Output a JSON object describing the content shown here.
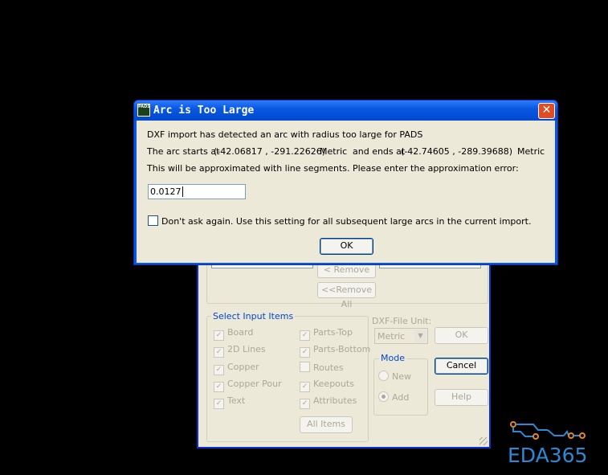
{
  "bg_dialog": {
    "remove_label": "< Remove",
    "remove_all_label": "<<Remove All",
    "select_input_items": {
      "title": "Select Input Items",
      "items": [
        {
          "label": "Board",
          "checked": true
        },
        {
          "label": "2D Lines",
          "checked": true
        },
        {
          "label": "Copper",
          "checked": true
        },
        {
          "label": "Copper Pour",
          "checked": true
        },
        {
          "label": "Text",
          "checked": true
        },
        {
          "label": "Parts-Top",
          "checked": true
        },
        {
          "label": "Parts-Bottom",
          "checked": true
        },
        {
          "label": "Routes",
          "checked": false
        },
        {
          "label": "Keepouts",
          "checked": true
        },
        {
          "label": "Attributes",
          "checked": true
        }
      ],
      "all_items_label": "All Items"
    },
    "dxf_file_unit": {
      "label": "DXF-File Unit:",
      "value": "Metric"
    },
    "ok_label": "OK",
    "cancel_label": "Cancel",
    "help_label": "Help",
    "mode": {
      "title": "Mode",
      "new_label": "New",
      "add_label": "Add",
      "selected": "Add"
    }
  },
  "dialog": {
    "title": "Arc is Too Large",
    "app_icon_text": "PADS",
    "line1": "DXF import has detected an arc with radius too large for PADS",
    "line2_prefix": "The arc starts at",
    "start_point": "(-42.06817 , -291.22626)",
    "start_unit": "Metric",
    "line2_mid": "and ends at",
    "end_point": "(-42.74605 , -289.39688)",
    "end_unit": "Metric",
    "line3": "This will be approximated with line segments. Please enter the approximation error:",
    "error_value": "0.0127",
    "dont_ask_label": "Don't ask again. Use this setting for all subsequent large arcs in the current import.",
    "dont_ask_checked": false,
    "ok_label": "OK"
  },
  "logo": {
    "text": "EDA365",
    "color": "#2a8ad4",
    "accent": "#e08a1e"
  }
}
